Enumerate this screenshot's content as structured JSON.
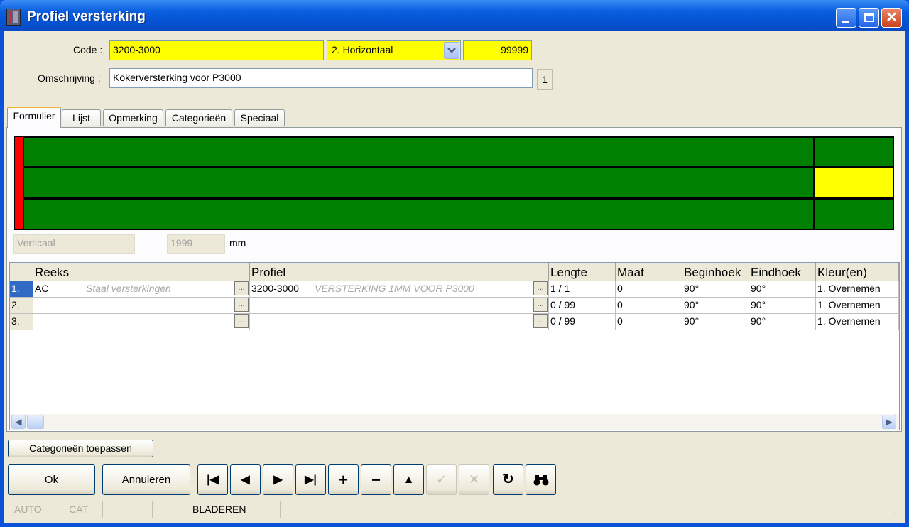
{
  "window": {
    "title": "Profiel versterking"
  },
  "header": {
    "code_label": "Code :",
    "code_value": "3200-3000",
    "orientation_value": "2.  Horizontaal",
    "number_value": "99999",
    "omschrijving_label": "Omschrijving :",
    "omschrijving_value": "Kokerversterking voor P3000",
    "counter": "1"
  },
  "tabs": [
    "Formulier",
    "Lijst",
    "Opmerking",
    "Categorieën",
    "Speciaal"
  ],
  "diagram": {
    "vertical_label": "Verticaal",
    "dimension_value": "1999",
    "unit": "mm"
  },
  "grid": {
    "columns": [
      "Reeks",
      "Profiel",
      "Lengte",
      "Maat",
      "Beginhoek",
      "Eindhoek",
      "Kleur(en)"
    ],
    "rows": [
      {
        "num": "1.",
        "reeks": "AC",
        "reeks_desc": "Staal versterkingen",
        "profiel": "3200-3000",
        "profiel_desc": "VERSTERKING 1MM VOOR P3000",
        "lengte": "1 / 1",
        "maat": "0",
        "beginhoek": "90°",
        "eindhoek": "90°",
        "kleur": "1. Overnemen"
      },
      {
        "num": "2.",
        "reeks": "",
        "reeks_desc": "",
        "profiel": "",
        "profiel_desc": "",
        "lengte": "0 / 99",
        "maat": "0",
        "beginhoek": "90°",
        "eindhoek": "90°",
        "kleur": "1. Overnemen"
      },
      {
        "num": "3.",
        "reeks": "",
        "reeks_desc": "",
        "profiel": "",
        "profiel_desc": "",
        "lengte": "0 / 99",
        "maat": "0",
        "beginhoek": "90°",
        "eindhoek": "90°",
        "kleur": "1. Overnemen"
      }
    ],
    "ellipsis": "..."
  },
  "buttons": {
    "categorieen": "Categorieën toepassen",
    "ok": "Ok",
    "annuleren": "Annuleren"
  },
  "nav_icons": [
    "first-record-icon",
    "previous-record-icon",
    "next-record-icon",
    "last-record-icon",
    "add-icon",
    "remove-icon",
    "up-icon",
    "confirm-icon",
    "cancel-edit-icon",
    "refresh-icon",
    "binoculars-icon"
  ],
  "status": {
    "auto": "AUTO",
    "cat": "CAT",
    "mode": "BLADEREN"
  },
  "colors": {
    "accent_yellow": "#ffff00",
    "diagram_green": "#008000",
    "diagram_red": "#ff0000",
    "selection_blue": "#316ac5"
  }
}
